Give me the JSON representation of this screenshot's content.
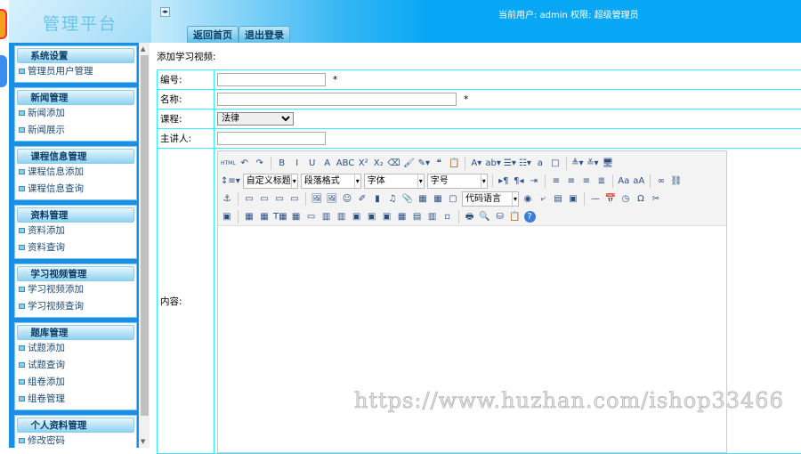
{
  "header": {
    "brand": "管理平台",
    "toggle_glyph": "◂▸",
    "tabs": [
      "返回首页",
      "退出登录"
    ],
    "user_label": "当前用户: admin 权限: 超级管理员"
  },
  "sidebar": {
    "groups": [
      {
        "title": "系统设置",
        "items": [
          "管理员用户管理"
        ]
      },
      {
        "title": "新闻管理",
        "items": [
          "新闻添加",
          "新闻展示"
        ]
      },
      {
        "title": "课程信息管理",
        "items": [
          "课程信息添加",
          "课程信息查询"
        ]
      },
      {
        "title": "资料管理",
        "items": [
          "资料添加",
          "资料查询"
        ]
      },
      {
        "title": "学习视频管理",
        "items": [
          "学习视频添加",
          "学习视频查询"
        ]
      },
      {
        "title": "题库管理",
        "items": [
          "试题添加",
          "试题查询",
          "组卷添加",
          "组卷管理"
        ]
      },
      {
        "title": "个人资料管理",
        "items": [
          "修改密码"
        ]
      }
    ]
  },
  "form": {
    "title": "添加学习视频:",
    "fields": {
      "code": {
        "label": "编号:",
        "value": "",
        "required": "*"
      },
      "name": {
        "label": "名称:",
        "value": "",
        "required": "*"
      },
      "course": {
        "label": "课程:",
        "value": "法律"
      },
      "lecturer": {
        "label": "主讲人:",
        "value": ""
      },
      "content": {
        "label": "内容:"
      }
    }
  },
  "editor": {
    "dropdowns": {
      "heading": "自定义标题",
      "paragraph": "段落格式",
      "font": "字体",
      "size": "字号",
      "code": "代码语言"
    },
    "rows": [
      [
        "html|HTML",
        "undo|↶",
        "redo|↷",
        "-",
        "bold|B",
        "italic|I",
        "underline|U",
        "fontborder|A",
        "strike|ABC",
        "superscript|X²",
        "subscript|X₂",
        "eraser|⌫",
        "formatbrush|🖌",
        "autotypeset|✎▾",
        "blockquote|❝",
        "pasteplain|📋",
        "-",
        "forecolor|A▾",
        "backcolor|ab▾",
        "orderedlist|☰▾",
        "unorderedlist|☷▾",
        "selectall|a",
        "cleardoc|□",
        "-",
        "rowspacingtop|≜▾",
        "rowspacingbottom|≚▾",
        "preview|🖥"
      ],
      [
        "lineheight|↕≡▾",
        "DD:heading",
        "DD:paragraph",
        "DD:font",
        "DD:size",
        "-",
        "ltr|▸¶",
        "rtl|¶◂",
        "indent|⇥",
        "-",
        "justifyleft|≡",
        "justifycenter|≡",
        "justifyright|≡",
        "justifyjustify|≣",
        "-",
        "touppercase|Aa",
        "tolowercase|aA",
        "-",
        "link|∞",
        "unlink|⛓"
      ],
      [
        "anchor|⚓",
        "-",
        "imagenone|▭",
        "imageleft|▭",
        "imageright|▭",
        "imagecenter|▭",
        "-",
        "simpleupload|🖼",
        "insertimage|🖼",
        "emotion|☺",
        "scrawl|✐",
        "insertvideo|▮",
        "music|♫",
        "attachment|📎",
        "map|▦",
        "gmap|▦",
        "insertframe|▢",
        "DD:code",
        "template|◉",
        "pagebreak|⤶",
        "background|▤",
        "wordimage|▣",
        "-",
        "horizontal|—",
        "date|📅",
        "time|◷",
        "spechars|Ω",
        "snapscreen|✂"
      ],
      [
        "edittip|▣",
        "-",
        "inserttable|▦",
        "deletetable|▦",
        "insertparagraph|T▦",
        "insertrow|▦",
        "deleterow|▭",
        "insertcol|▥",
        "deletecol|▥",
        "mergecells|▣",
        "mergeright|▣",
        "mergedown|▣",
        "splittocells|▦",
        "splittorows|▤",
        "splittocols|▥",
        "charts|▫",
        "-",
        "print|🖶",
        "searchreplace|🔍",
        "drafts|⛁",
        "paste|📋",
        "help|?"
      ]
    ]
  },
  "watermark": "https://www.huzhan.com/ishop33466"
}
